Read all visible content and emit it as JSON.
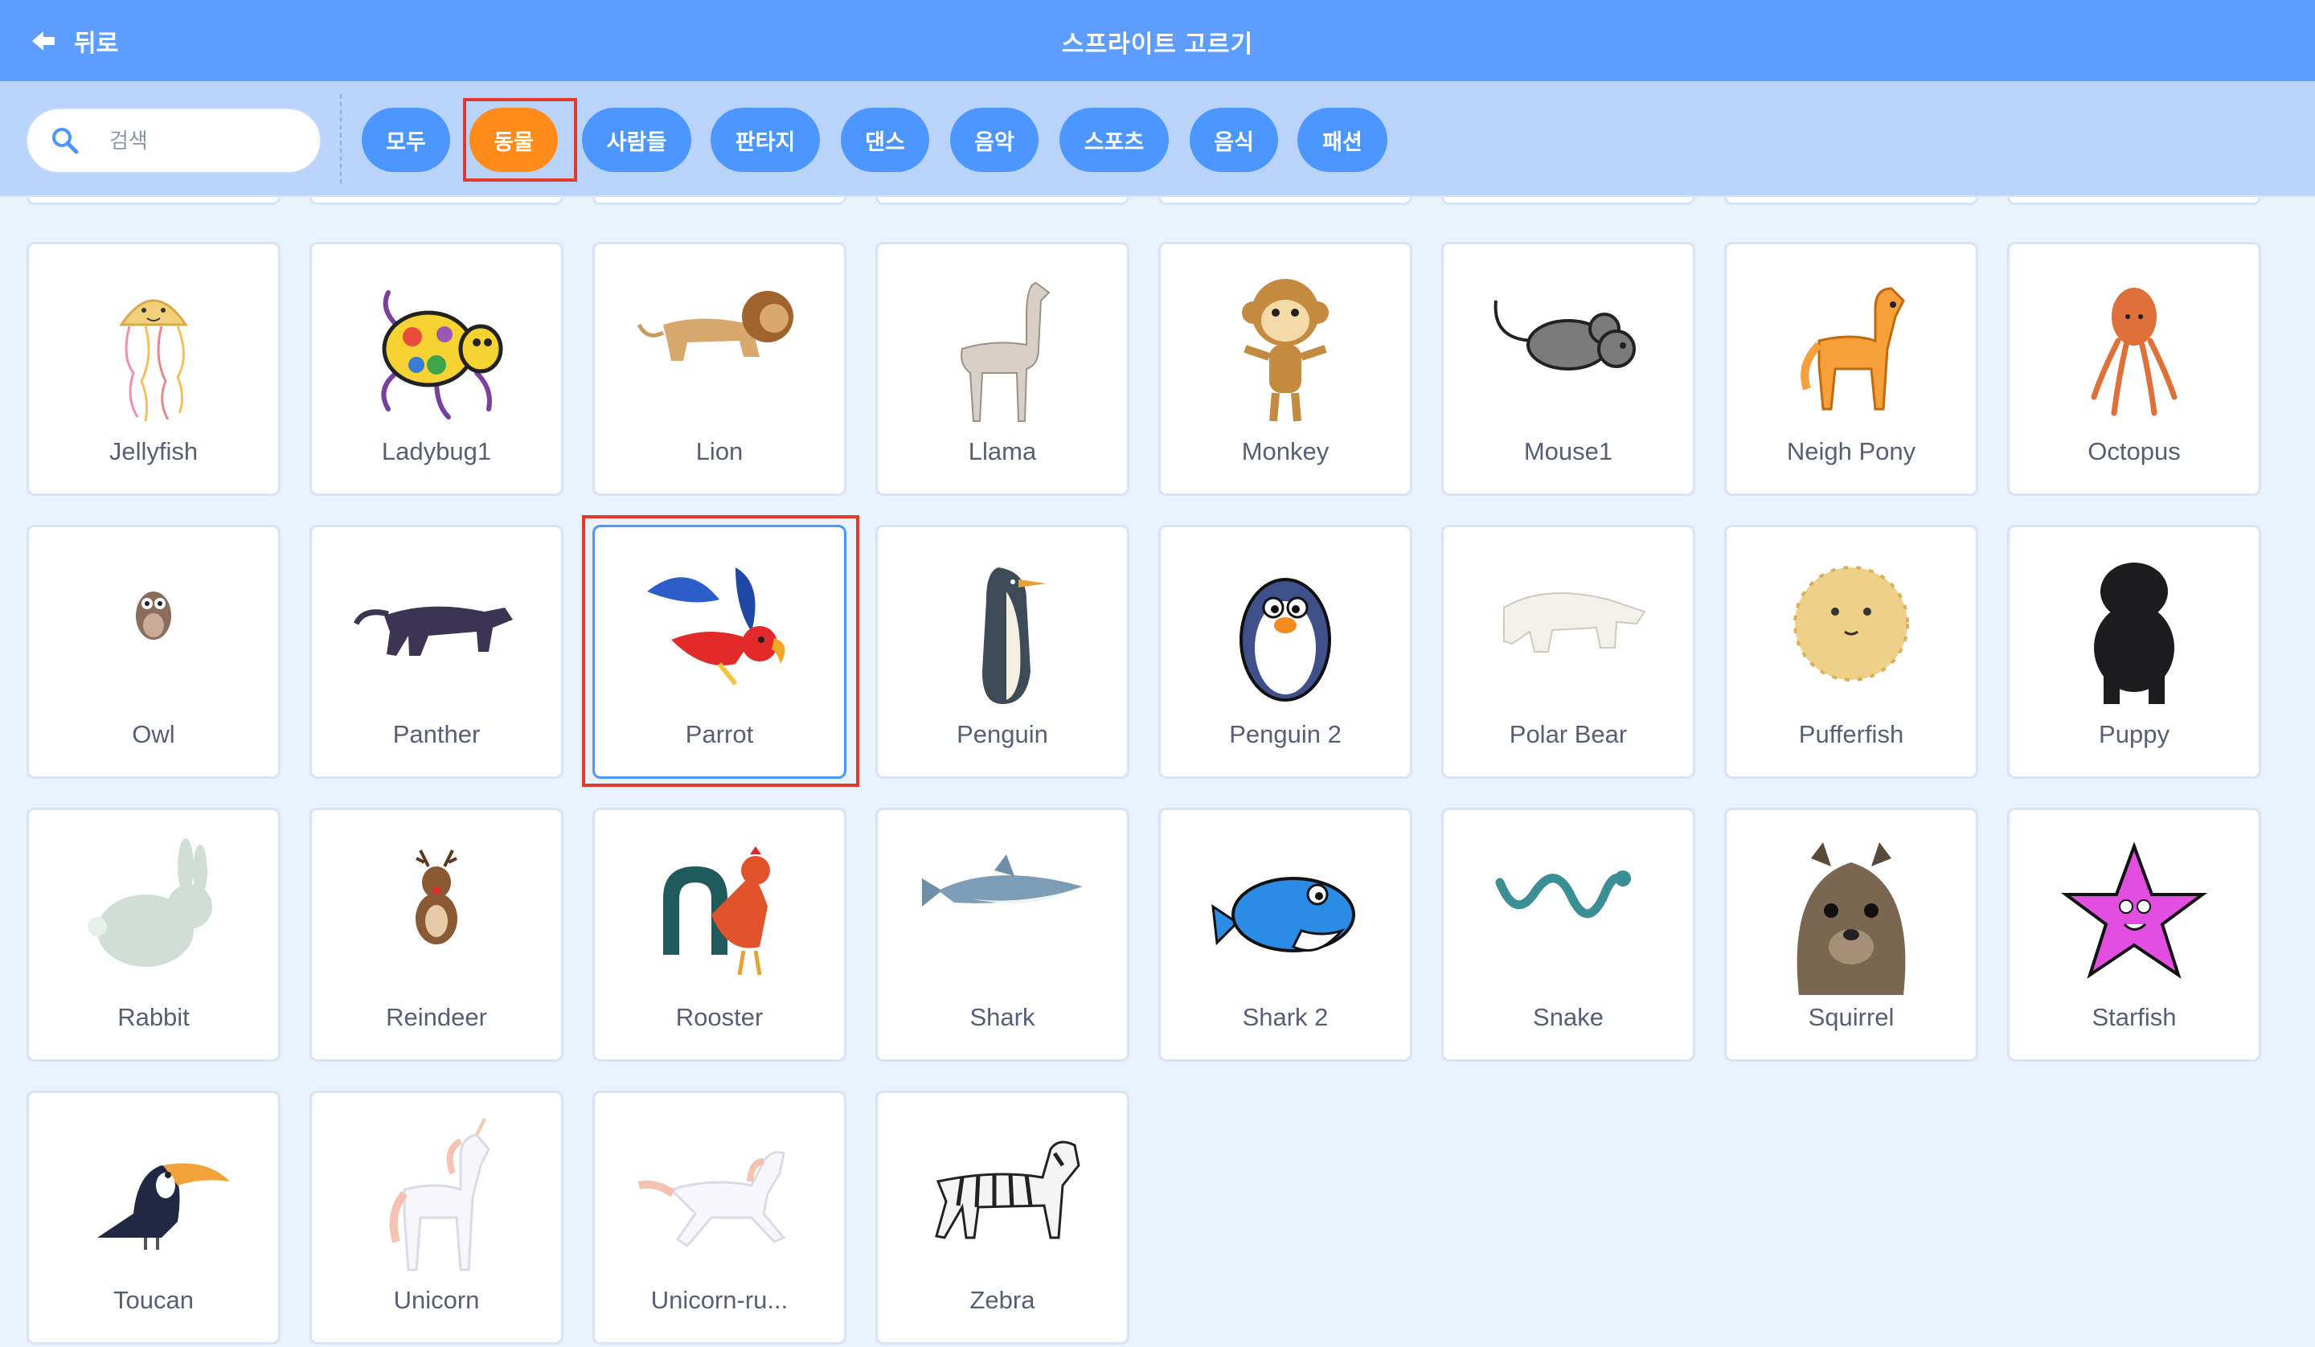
{
  "header": {
    "back_label": "뒤로",
    "title": "스프라이트 고르기",
    "bg_color": "#5c9dff"
  },
  "search": {
    "placeholder": "검색",
    "value": ""
  },
  "categories": [
    {
      "label": "모두",
      "active": false
    },
    {
      "label": "동물",
      "active": true
    },
    {
      "label": "사람들",
      "active": false
    },
    {
      "label": "판타지",
      "active": false
    },
    {
      "label": "댄스",
      "active": false
    },
    {
      "label": "음악",
      "active": false
    },
    {
      "label": "스포츠",
      "active": false
    },
    {
      "label": "음식",
      "active": false
    },
    {
      "label": "패션",
      "active": false
    }
  ],
  "colors": {
    "tag": "#4c97ff",
    "tag_active": "#ff8c1a",
    "highlight": "#e0392b",
    "card_label": "#575e75"
  },
  "sprites": [
    {
      "name": "Jellyfish",
      "icon": "jellyfish-icon"
    },
    {
      "name": "Ladybug1",
      "icon": "ladybug-icon"
    },
    {
      "name": "Lion",
      "icon": "lion-icon"
    },
    {
      "name": "Llama",
      "icon": "llama-icon"
    },
    {
      "name": "Monkey",
      "icon": "monkey-icon"
    },
    {
      "name": "Mouse1",
      "icon": "mouse-icon"
    },
    {
      "name": "Neigh Pony",
      "icon": "pony-icon"
    },
    {
      "name": "Octopus",
      "icon": "octopus-icon"
    },
    {
      "name": "Owl",
      "icon": "owl-icon"
    },
    {
      "name": "Panther",
      "icon": "panther-icon"
    },
    {
      "name": "Parrot",
      "icon": "parrot-icon",
      "selected": true
    },
    {
      "name": "Penguin",
      "icon": "penguin-icon"
    },
    {
      "name": "Penguin 2",
      "icon": "penguin2-icon"
    },
    {
      "name": "Polar Bear",
      "icon": "polar-bear-icon"
    },
    {
      "name": "Pufferfish",
      "icon": "pufferfish-icon"
    },
    {
      "name": "Puppy",
      "icon": "puppy-icon"
    },
    {
      "name": "Rabbit",
      "icon": "rabbit-icon"
    },
    {
      "name": "Reindeer",
      "icon": "reindeer-icon"
    },
    {
      "name": "Rooster",
      "icon": "rooster-icon"
    },
    {
      "name": "Shark",
      "icon": "shark-icon"
    },
    {
      "name": "Shark 2",
      "icon": "shark2-icon"
    },
    {
      "name": "Snake",
      "icon": "snake-icon"
    },
    {
      "name": "Squirrel",
      "icon": "squirrel-icon"
    },
    {
      "name": "Starfish",
      "icon": "starfish-icon"
    },
    {
      "name": "Toucan",
      "icon": "toucan-icon"
    },
    {
      "name": "Unicorn",
      "icon": "unicorn-icon"
    },
    {
      "name": "Unicorn-ru...",
      "icon": "unicorn-running-icon"
    },
    {
      "name": "Zebra",
      "icon": "zebra-icon"
    }
  ]
}
